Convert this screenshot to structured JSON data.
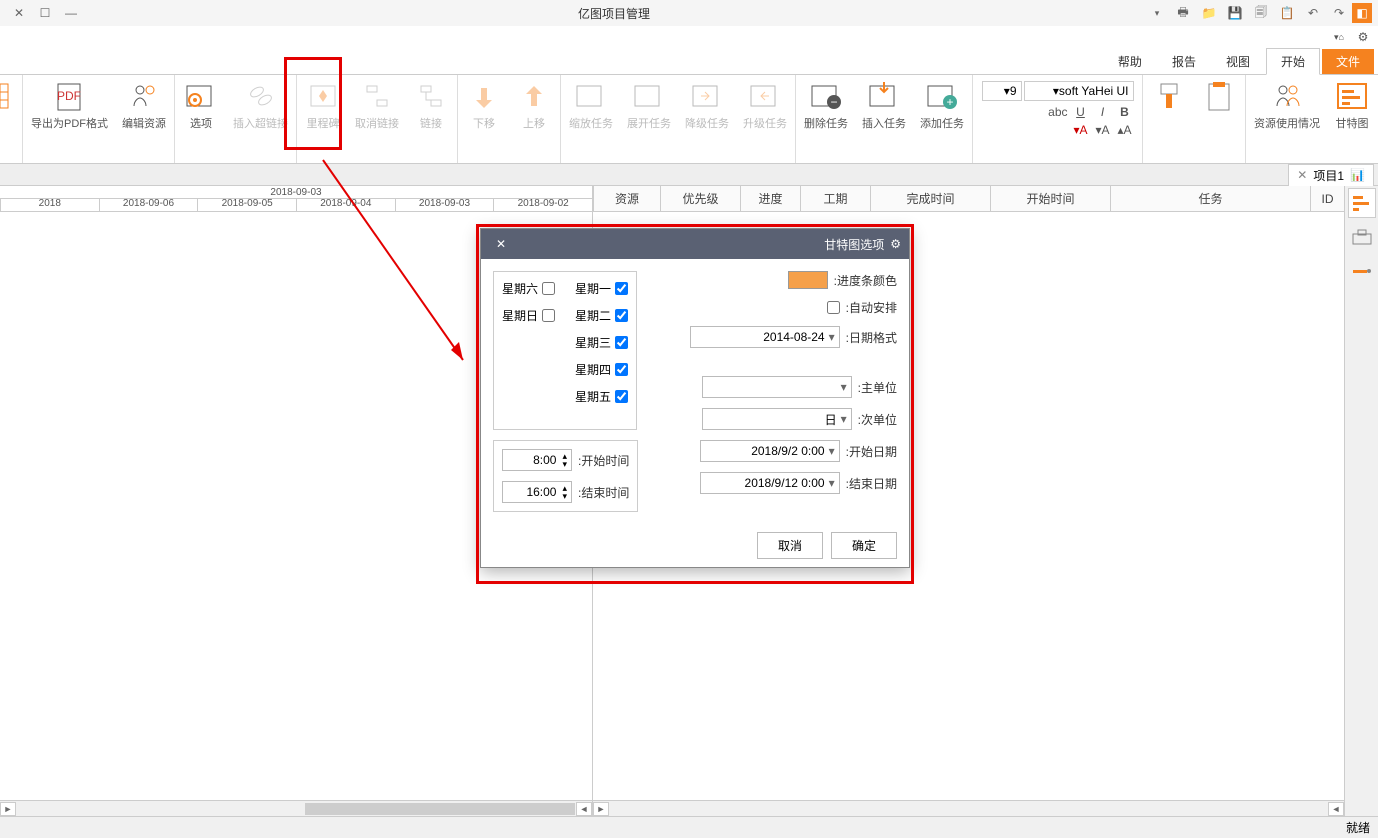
{
  "title": "亿图项目管理",
  "tabs": {
    "file": "文件",
    "start": "开始",
    "view": "视图",
    "report": "报告",
    "help": "帮助"
  },
  "ribbon": {
    "gantt": "甘特图",
    "res": "资源使用情况",
    "font": {
      "name": "soft YaHei UI",
      "size": "9"
    },
    "addtask": "添加任务",
    "instask": "插入任务",
    "deltask": "删除任务",
    "upgrade": "升级任务",
    "downgrade": "降级任务",
    "open": "展开任务",
    "close": "缩放任务",
    "up": "上移",
    "down": "下移",
    "link": "链接",
    "unlink": "取消链接",
    "deltask2": "删除",
    "option": "选项",
    "inslink": "插入超链接",
    "editlink": "里程碑",
    "editres": "编辑资源",
    "exportpdf": "导出为PDF格式"
  },
  "doc": {
    "name": "项目1"
  },
  "grid": {
    "id": "ID",
    "name": "任务",
    "start": "开始时间",
    "end": "完成时间",
    "dur": "工期",
    "prog": "进度",
    "pred": "优先级",
    "res": "资源"
  },
  "tl": {
    "top": "2018-09-03",
    "d": [
      "2018-09-02",
      "2018-09-03",
      "2018-09-04",
      "2018-09-05",
      "2018-09-06",
      "2018"
    ]
  },
  "status": "就绪",
  "dlg": {
    "title": "甘特图选项",
    "bar": "进度条颜色:",
    "auto": "自动安排:",
    "fmt": "日期格式:",
    "fmtv": "2014-08-24",
    "main": "主单位:",
    "sub": "次单位:",
    "subv": "日",
    "days": {
      "mon": "星期一",
      "tue": "星期二",
      "wed": "星期三",
      "thu": "星期四",
      "fri": "星期五",
      "sat": "星期六",
      "sun": "星期日"
    },
    "sdate": "开始日期:",
    "sdatev": "2018/9/2 0:00",
    "edate": "结束日期:",
    "edatev": "2018/9/12 0:00",
    "stime": "开始时间:",
    "stimev": "8:00",
    "etime": "结束时间:",
    "etimev": "16:00",
    "ok": "确定",
    "cancel": "取消"
  }
}
